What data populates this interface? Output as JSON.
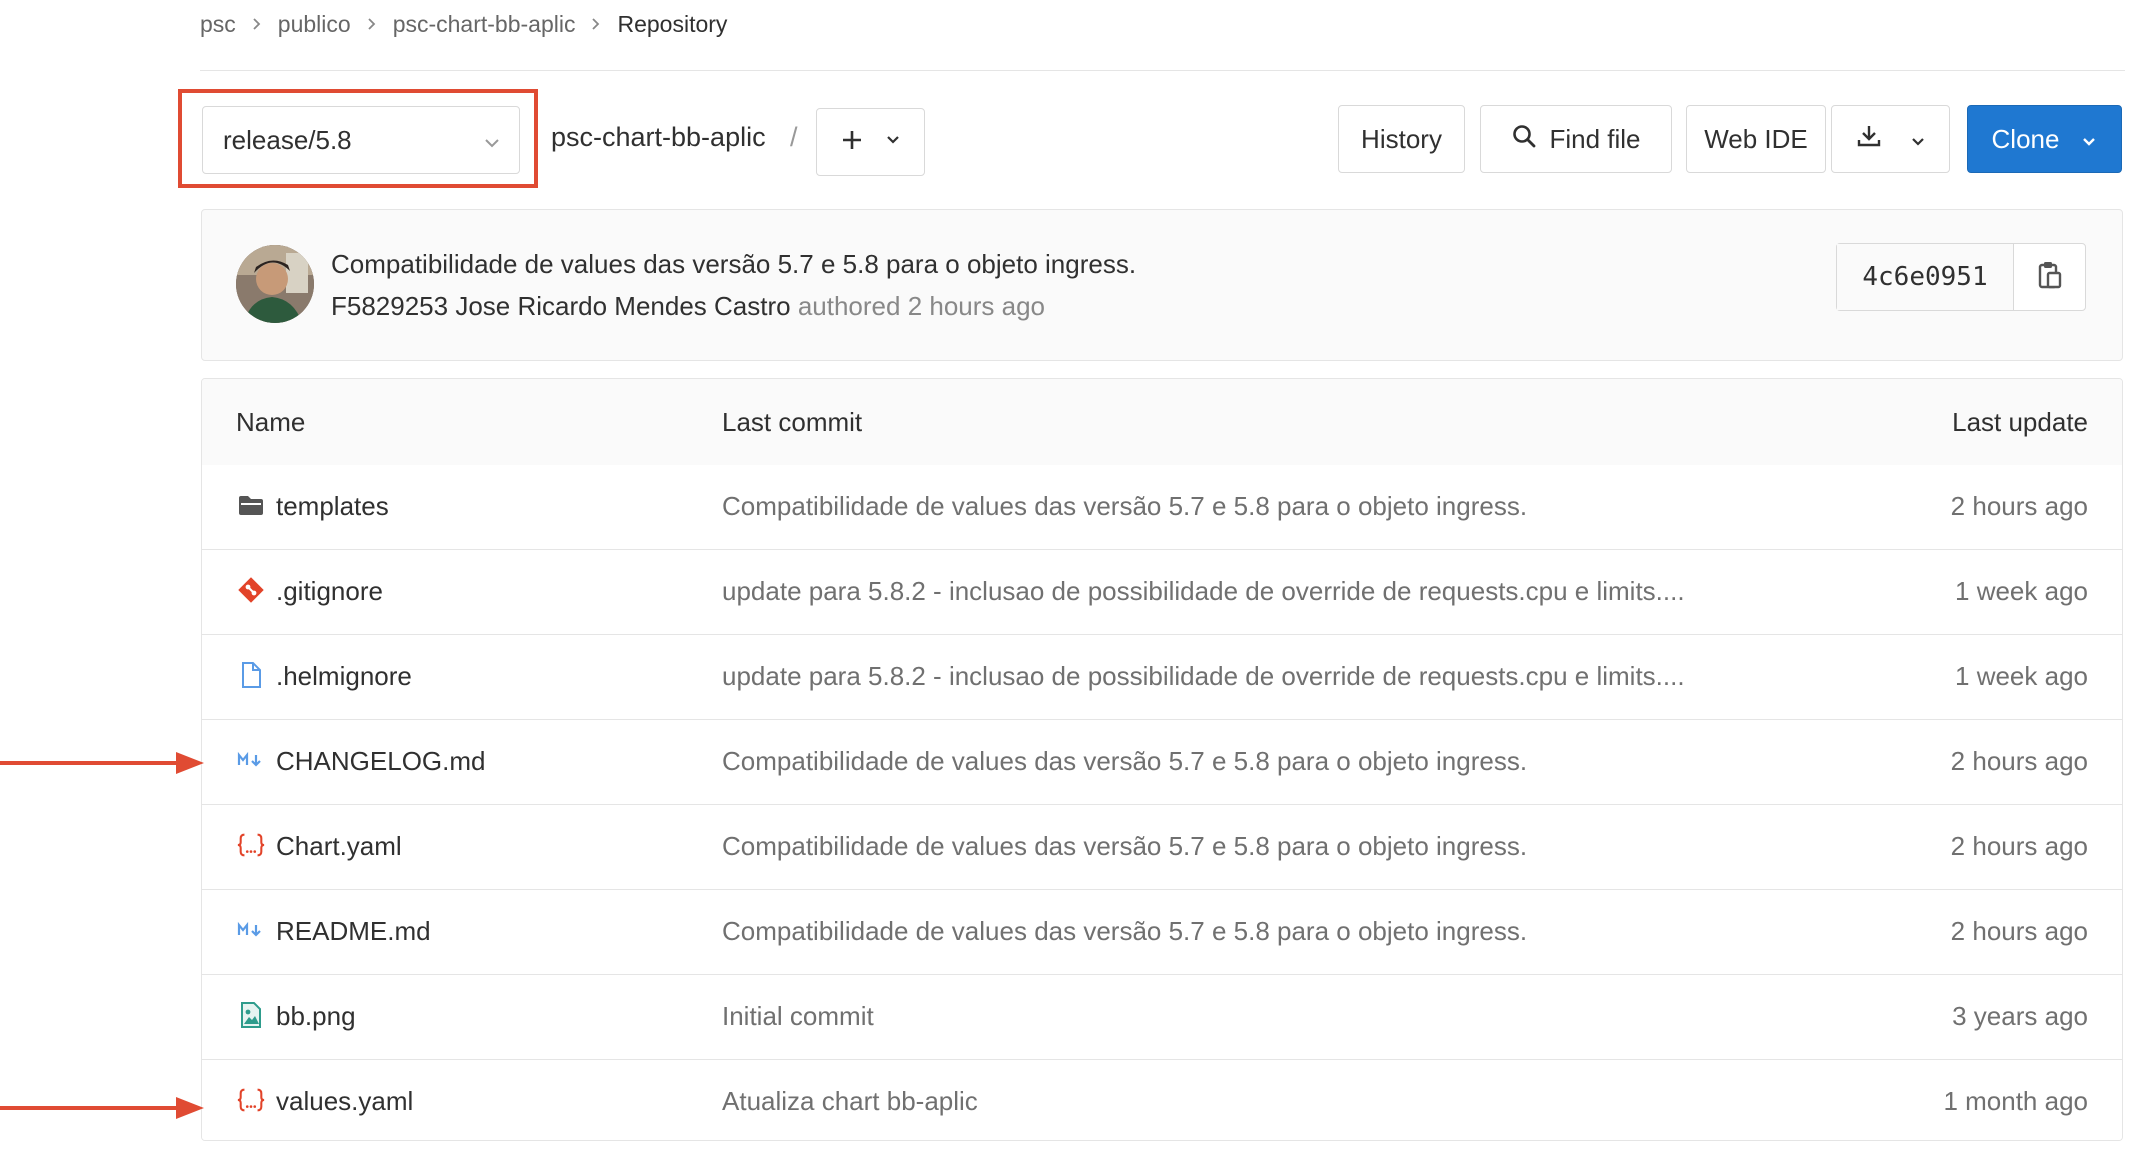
{
  "breadcrumb": [
    {
      "label": "psc"
    },
    {
      "label": "publico"
    },
    {
      "label": "psc-chart-bb-aplic"
    },
    {
      "label": "Repository"
    }
  ],
  "toolbar": {
    "branch": "release/5.8",
    "repo_path": "psc-chart-bb-aplic",
    "path_separator": "/",
    "history_label": "History",
    "find_file_label": "Find file",
    "web_ide_label": "Web IDE",
    "clone_label": "Clone"
  },
  "last_commit": {
    "title": "Compatibilidade de values das versão 5.7 e 5.8 para o objeto ingress.",
    "author": "F5829253 Jose Ricardo Mendes Castro",
    "authored_text": "authored 2 hours ago",
    "sha": "4c6e0951"
  },
  "table": {
    "headers": {
      "name": "Name",
      "last_commit": "Last commit",
      "last_update": "Last update"
    },
    "rows": [
      {
        "icon": "folder-icon",
        "name": "templates",
        "commit": "Compatibilidade de values das versão 5.7 e 5.8 para o objeto ingress.",
        "date": "2 hours ago"
      },
      {
        "icon": "git-icon",
        "name": ".gitignore",
        "commit": "update para 5.8.2 - inclusao de possibilidade de override de requests.cpu e limits....",
        "date": "1 week ago"
      },
      {
        "icon": "file-icon",
        "name": ".helmignore",
        "commit": "update para 5.8.2 - inclusao de possibilidade de override de requests.cpu e limits....",
        "date": "1 week ago"
      },
      {
        "icon": "markdown-icon",
        "name": "CHANGELOG.md",
        "commit": "Compatibilidade de values das versão 5.7 e 5.8 para o objeto ingress.",
        "date": "2 hours ago"
      },
      {
        "icon": "yaml-icon",
        "name": "Chart.yaml",
        "commit": "Compatibilidade de values das versão 5.7 e 5.8 para o objeto ingress.",
        "date": "2 hours ago"
      },
      {
        "icon": "markdown-icon",
        "name": "README.md",
        "commit": "Compatibilidade de values das versão 5.7 e 5.8 para o objeto ingress.",
        "date": "2 hours ago"
      },
      {
        "icon": "image-file-icon",
        "name": "bb.png",
        "commit": "Initial commit",
        "date": "3 years ago"
      },
      {
        "icon": "yaml-icon",
        "name": "values.yaml",
        "commit": "Atualiza chart bb-aplic",
        "date": "1 month ago"
      }
    ]
  },
  "colors": {
    "accent_blue": "#1f78d1",
    "annotation_red": "#e04b33",
    "git_orange": "#e24329",
    "markdown_blue": "#5a9be6",
    "image_teal": "#2e9c8c"
  }
}
